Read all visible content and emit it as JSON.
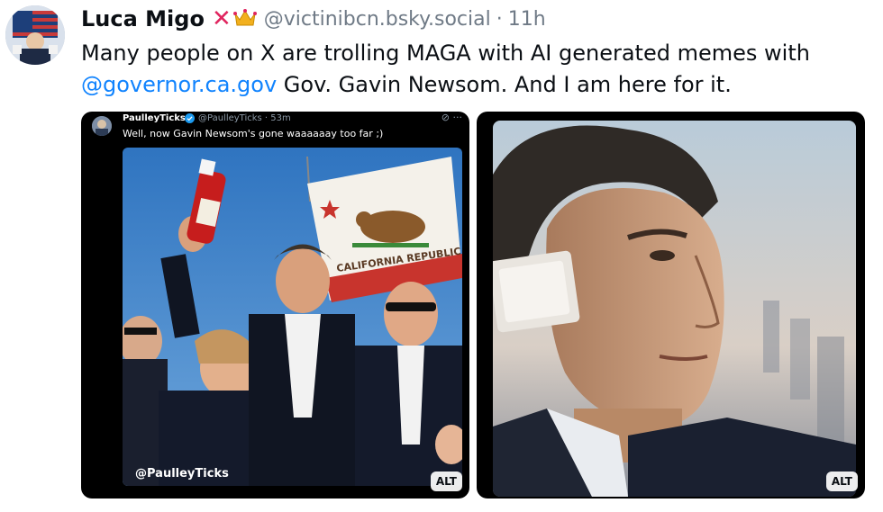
{
  "post": {
    "author": {
      "display_name": "Luca Migo",
      "handle": "@victinibcn.bsky.social",
      "separator": "·",
      "time": "11h",
      "emojis": [
        "cross-mark-emoji",
        "crown-emoji"
      ]
    },
    "text_before": "Many people on X are trolling MAGA with AI generated memes with ",
    "mention": "@governor.ca.gov",
    "text_after": " Gov. Gavin Newsom. And I am here for it."
  },
  "images": [
    {
      "alt_label": "ALT",
      "inner_post": {
        "name": "PaulleyTicks",
        "handle": "@PaulleyTicks · 53m",
        "text": "Well, now Gavin Newsom's gone waaaaaay too far ;)",
        "icons": "⊘ ···"
      },
      "flag_text": "CALIFORNIA REPUBLIC",
      "watermark": "@PaulleyTicks"
    },
    {
      "alt_label": "ALT"
    }
  ],
  "colors": {
    "mention": "#1083fe",
    "muted": "#6f7a86",
    "flag_red": "#c8342d",
    "sky": "#3b82c8"
  }
}
